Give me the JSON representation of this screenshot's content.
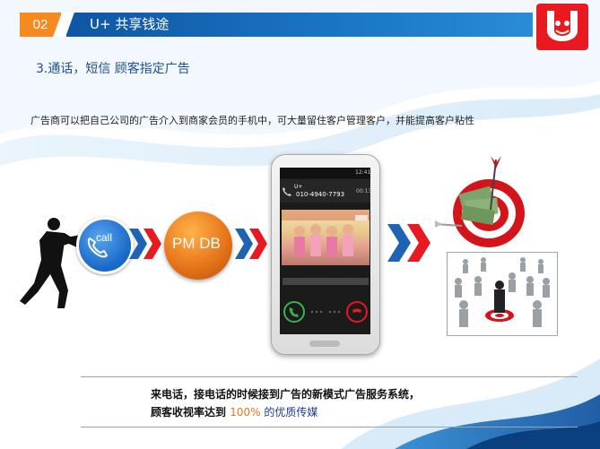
{
  "header": {
    "section_number": "02",
    "title": "U+ 共享钱途"
  },
  "subtitle": "3.通话，短信 顾客指定广告",
  "description": "广告商可以把自己公司的广告介入到商家会员的手机中，可大量留住客户管理客户，并能提高客户粘性",
  "flow": {
    "call_label": "call",
    "pmdb_label": "PM DB"
  },
  "phone": {
    "status_time": "12:41",
    "caller_tag": "U+",
    "caller_number": "010-4940-7793",
    "call_duration": "00:13"
  },
  "caption": {
    "line1": "来电话，接电话的时候接到广告的新模式广告服务系统，",
    "line2_prefix": "顾客收视率达到 ",
    "line2_highlight": "100%",
    "line2_suffix": " 的优质传媒"
  },
  "colors": {
    "header_orange": "#f6891f",
    "header_blue": "#0f56a3",
    "accent_red": "#e8191f",
    "call_blue": "#1667c7",
    "pmdb_orange": "#e8761a",
    "highlight_orange": "#e8761a"
  },
  "icons": [
    "businessman-pushing-icon",
    "phone-handset-icon",
    "double-chevron-arrow-icon",
    "target-money-icon",
    "crowd-target-icon",
    "logo-icon"
  ]
}
